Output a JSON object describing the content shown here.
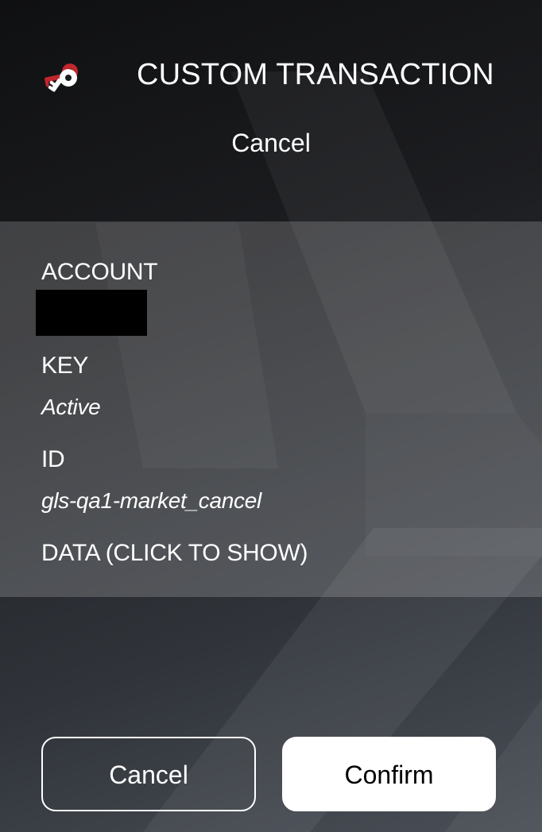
{
  "header": {
    "title": "CUSTOM TRANSACTION",
    "subtitle": "Cancel",
    "logo_icon": "keys-icon",
    "accent_color": "#c0272d"
  },
  "details": {
    "account_label": "ACCOUNT",
    "key_label": "KEY",
    "key_value": "Active",
    "id_label": "ID",
    "id_value": "gls-qa1-market_cancel",
    "data_label": "DATA (CLICK TO SHOW)"
  },
  "actions": {
    "cancel_label": "Cancel",
    "confirm_label": "Confirm"
  }
}
